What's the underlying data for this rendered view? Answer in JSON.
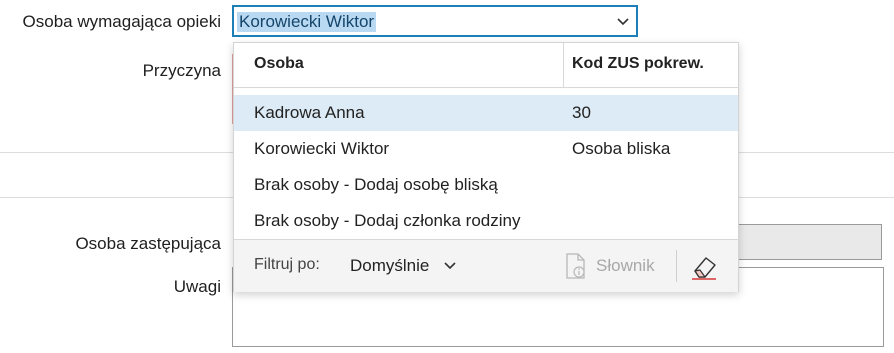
{
  "labels": {
    "caregiver": "Osoba wymagająca opieki",
    "reason": "Przyczyna",
    "substitute": "Osoba zastępująca",
    "notes": "Uwagi"
  },
  "combo": {
    "value": "Korowiecki Wiktor"
  },
  "dropdown": {
    "columns": [
      "Osoba",
      "Kod ZUS pokrew."
    ],
    "rows": [
      {
        "person": "Kadrowa Anna",
        "code": "30",
        "highlighted": true
      },
      {
        "person": "Korowiecki Wiktor",
        "code": "Osoba bliska",
        "highlighted": false
      },
      {
        "person": "Brak osoby - Dodaj osobę bliską",
        "code": "",
        "highlighted": false
      },
      {
        "person": "Brak osoby - Dodaj członka rodziny",
        "code": "",
        "highlighted": false
      }
    ],
    "footer": {
      "filter_label": "Filtruj po:",
      "filter_value": "Domyślnie",
      "dictionary_label": "Słownik"
    }
  },
  "colors": {
    "focus_border": "#1d7fb8",
    "selection_bg": "#b8d9f1",
    "row_highlight": "#dcebf6",
    "eraser_accent": "#d9534f"
  },
  "icons": [
    "chevron-down-icon",
    "dictionary-info-icon",
    "eraser-icon"
  ]
}
